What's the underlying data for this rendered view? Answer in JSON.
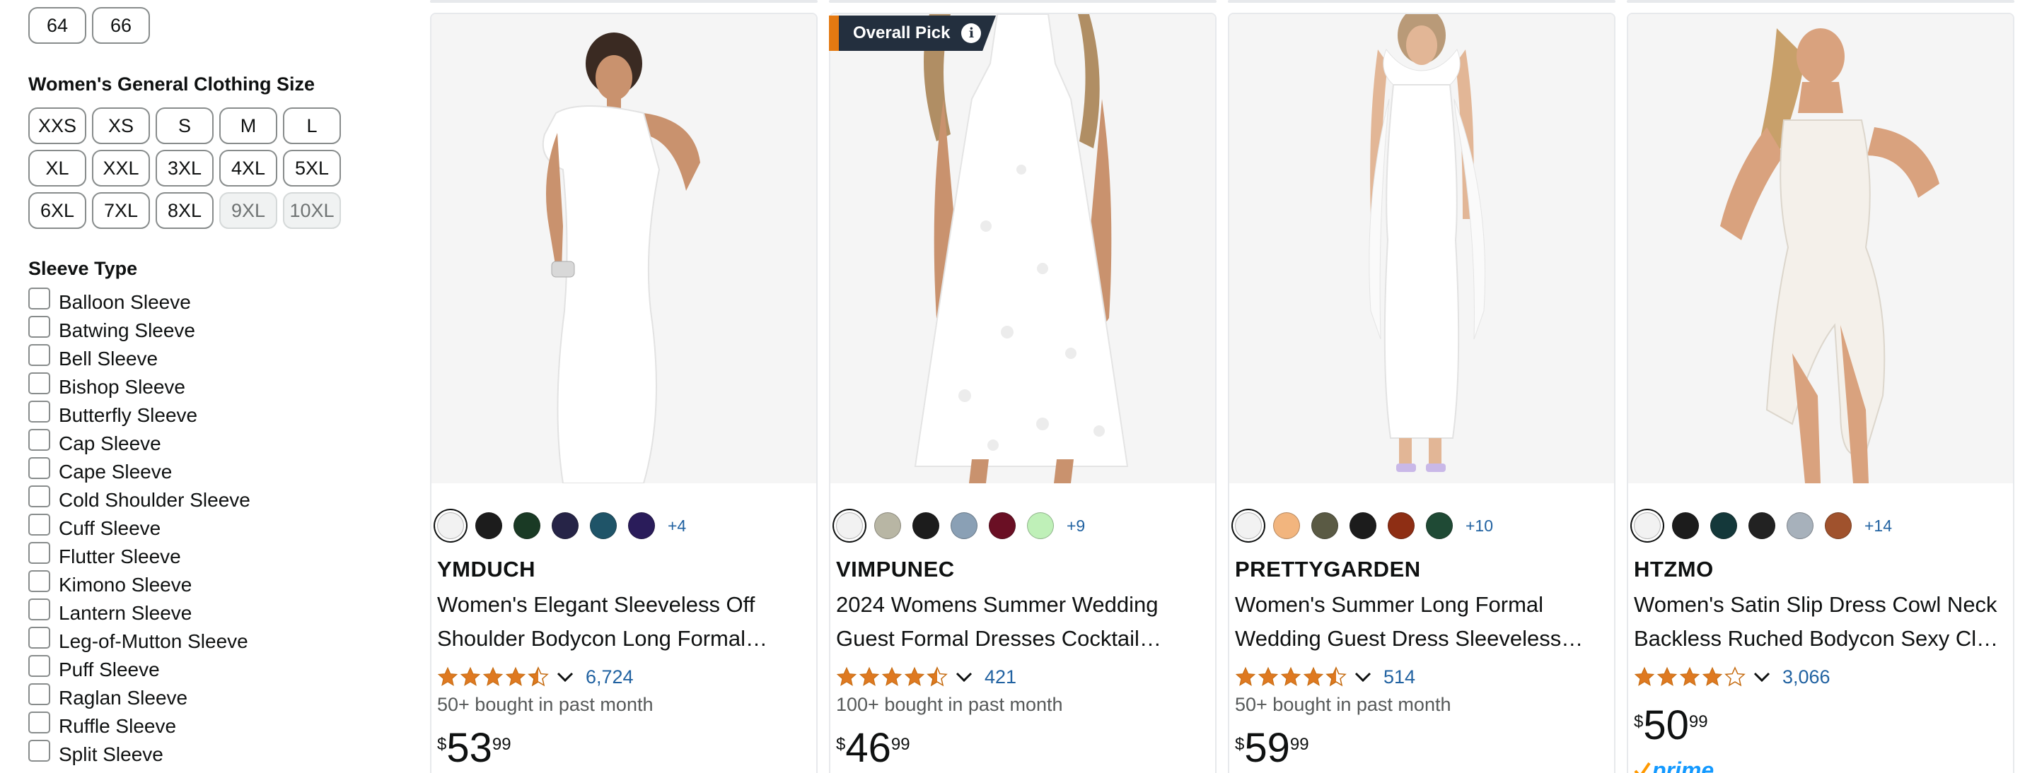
{
  "sidebar": {
    "prev_sizes": [
      "64",
      "66"
    ],
    "size_heading": "Women's General Clothing Size",
    "sizes": [
      {
        "label": "XXS",
        "disabled": false
      },
      {
        "label": "XS",
        "disabled": false
      },
      {
        "label": "S",
        "disabled": false
      },
      {
        "label": "M",
        "disabled": false
      },
      {
        "label": "L",
        "disabled": false
      },
      {
        "label": "XL",
        "disabled": false
      },
      {
        "label": "XXL",
        "disabled": false
      },
      {
        "label": "3XL",
        "disabled": false
      },
      {
        "label": "4XL",
        "disabled": false
      },
      {
        "label": "5XL",
        "disabled": false
      },
      {
        "label": "6XL",
        "disabled": false
      },
      {
        "label": "7XL",
        "disabled": false
      },
      {
        "label": "8XL",
        "disabled": false
      },
      {
        "label": "9XL",
        "disabled": true
      },
      {
        "label": "10XL",
        "disabled": true
      }
    ],
    "sleeve_heading": "Sleeve Type",
    "sleeve_types": [
      "Balloon Sleeve",
      "Batwing Sleeve",
      "Bell Sleeve",
      "Bishop Sleeve",
      "Butterfly Sleeve",
      "Cap Sleeve",
      "Cape Sleeve",
      "Cold Shoulder Sleeve",
      "Cuff Sleeve",
      "Flutter Sleeve",
      "Kimono Sleeve",
      "Lantern Sleeve",
      "Leg-of-Mutton Sleeve",
      "Puff Sleeve",
      "Raglan Sleeve",
      "Ruffle Sleeve",
      "Split Sleeve"
    ]
  },
  "products": [
    {
      "badge": "",
      "swatches": [
        "#f2f2f2",
        "#1c1c1c",
        "#1a3a25",
        "#262447",
        "#1f5468",
        "#2a1c5a"
      ],
      "more_colors": "+4",
      "brand": "YMDUCH",
      "title_line1": "Women's Elegant Sleeveless Off",
      "title_line2": "Shoulder Bodycon Long Formal…",
      "rating": 4.5,
      "reviews": "6,724",
      "bought": "50+ bought in past month",
      "price_symbol": "$",
      "price_whole": "53",
      "price_fraction": "99",
      "prime": ""
    },
    {
      "badge": "Overall Pick",
      "swatches": [
        "#f2f2f2",
        "#b8b6a4",
        "#1c1c1c",
        "#8aa0b5",
        "#6a0f24",
        "#bff0b8"
      ],
      "more_colors": "+9",
      "brand": "VIMPUNEC",
      "title_line1": "2024 Womens Summer Wedding",
      "title_line2": "Guest Formal Dresses Cocktail…",
      "rating": 4.5,
      "reviews": "421",
      "bought": "100+ bought in past month",
      "price_symbol": "$",
      "price_whole": "46",
      "price_fraction": "99",
      "prime": ""
    },
    {
      "badge": "",
      "swatches": [
        "#f2f2f2",
        "#f2b57e",
        "#5a5a44",
        "#1c1c1c",
        "#8e2e14",
        "#1f4a35"
      ],
      "more_colors": "+10",
      "brand": "PRETTYGARDEN",
      "title_line1": "Women's Summer Long Formal",
      "title_line2": "Wedding Guest Dress Sleeveless…",
      "rating": 4.5,
      "reviews": "514",
      "bought": "50+ bought in past month",
      "price_symbol": "$",
      "price_whole": "59",
      "price_fraction": "99",
      "prime": ""
    },
    {
      "badge": "",
      "swatches": [
        "#f2f2f2",
        "#1c1c1c",
        "#14383a",
        "#222222",
        "#a7b1bb",
        "#a0522d"
      ],
      "more_colors": "+14",
      "brand": "HTZMO",
      "title_line1": "Women's Satin Slip Dress Cowl Neck",
      "title_line2": "Backless Ruched Bodycon Sexy Cl…",
      "rating": 4,
      "reviews": "3,066",
      "bought": "",
      "price_symbol": "$",
      "price_whole": "50",
      "price_fraction": "99",
      "prime": "prime"
    }
  ],
  "colors": {
    "link": "#2162a1",
    "star": "#de7921",
    "badge_bg": "#232f3e",
    "badge_accent": "#e47911",
    "prime": "#1399ff"
  }
}
